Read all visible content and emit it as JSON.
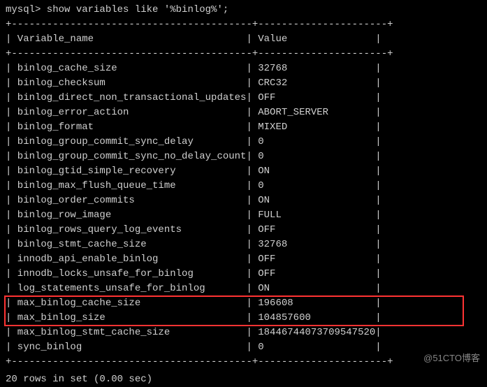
{
  "prompt": "mysql> show variables like '%binlog%';",
  "columns": {
    "name": "Variable_name",
    "value": "Value"
  },
  "sep_top": "+-----------------------------------------+----------------------+",
  "rows": [
    {
      "name": "binlog_cache_size",
      "value": "32768"
    },
    {
      "name": "binlog_checksum",
      "value": "CRC32"
    },
    {
      "name": "binlog_direct_non_transactional_updates",
      "value": "OFF"
    },
    {
      "name": "binlog_error_action",
      "value": "ABORT_SERVER"
    },
    {
      "name": "binlog_format",
      "value": "MIXED"
    },
    {
      "name": "binlog_group_commit_sync_delay",
      "value": "0"
    },
    {
      "name": "binlog_group_commit_sync_no_delay_count",
      "value": "0"
    },
    {
      "name": "binlog_gtid_simple_recovery",
      "value": "ON"
    },
    {
      "name": "binlog_max_flush_queue_time",
      "value": "0"
    },
    {
      "name": "binlog_order_commits",
      "value": "ON"
    },
    {
      "name": "binlog_row_image",
      "value": "FULL"
    },
    {
      "name": "binlog_rows_query_log_events",
      "value": "OFF"
    },
    {
      "name": "binlog_stmt_cache_size",
      "value": "32768"
    },
    {
      "name": "innodb_api_enable_binlog",
      "value": "OFF"
    },
    {
      "name": "innodb_locks_unsafe_for_binlog",
      "value": "OFF"
    },
    {
      "name": "log_statements_unsafe_for_binlog",
      "value": "ON"
    },
    {
      "name": "max_binlog_cache_size",
      "value": "196608",
      "hl": true
    },
    {
      "name": "max_binlog_size",
      "value": "104857600",
      "hl": true
    },
    {
      "name": "max_binlog_stmt_cache_size",
      "value": "18446744073709547520"
    },
    {
      "name": "sync_binlog",
      "value": "0"
    }
  ],
  "result": "20 rows in set (0.00 sec)",
  "watermark": "@51CTO博客"
}
